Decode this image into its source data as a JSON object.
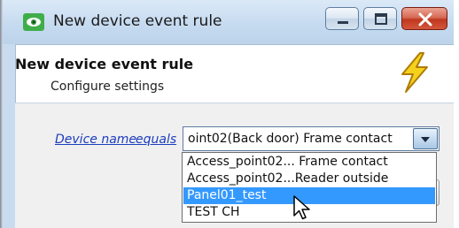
{
  "window": {
    "title": "New device event rule",
    "buttons": {
      "minimize": "minimize",
      "maximize": "maximize",
      "close": "close"
    }
  },
  "header": {
    "title": "New device event rule",
    "subtitle": "Configure settings",
    "icon": "lightning-bolt-icon"
  },
  "rule": {
    "field_link": "Device name",
    "operator_link": "equals",
    "selected_value": "oint02(Back door) Frame contact"
  },
  "dropdown": {
    "options": [
      {
        "label": "Access_point02... Frame contact",
        "selected": false
      },
      {
        "label": "Access_point02...Reader outside",
        "selected": false
      },
      {
        "label": "Panel01_test",
        "selected": true
      },
      {
        "label": "TEST CH",
        "selected": false
      }
    ]
  },
  "colors": {
    "selection": "#3399ff",
    "link": "#1c3dbd",
    "close_button": "#c0381f",
    "bolt": "#f4d21c"
  }
}
